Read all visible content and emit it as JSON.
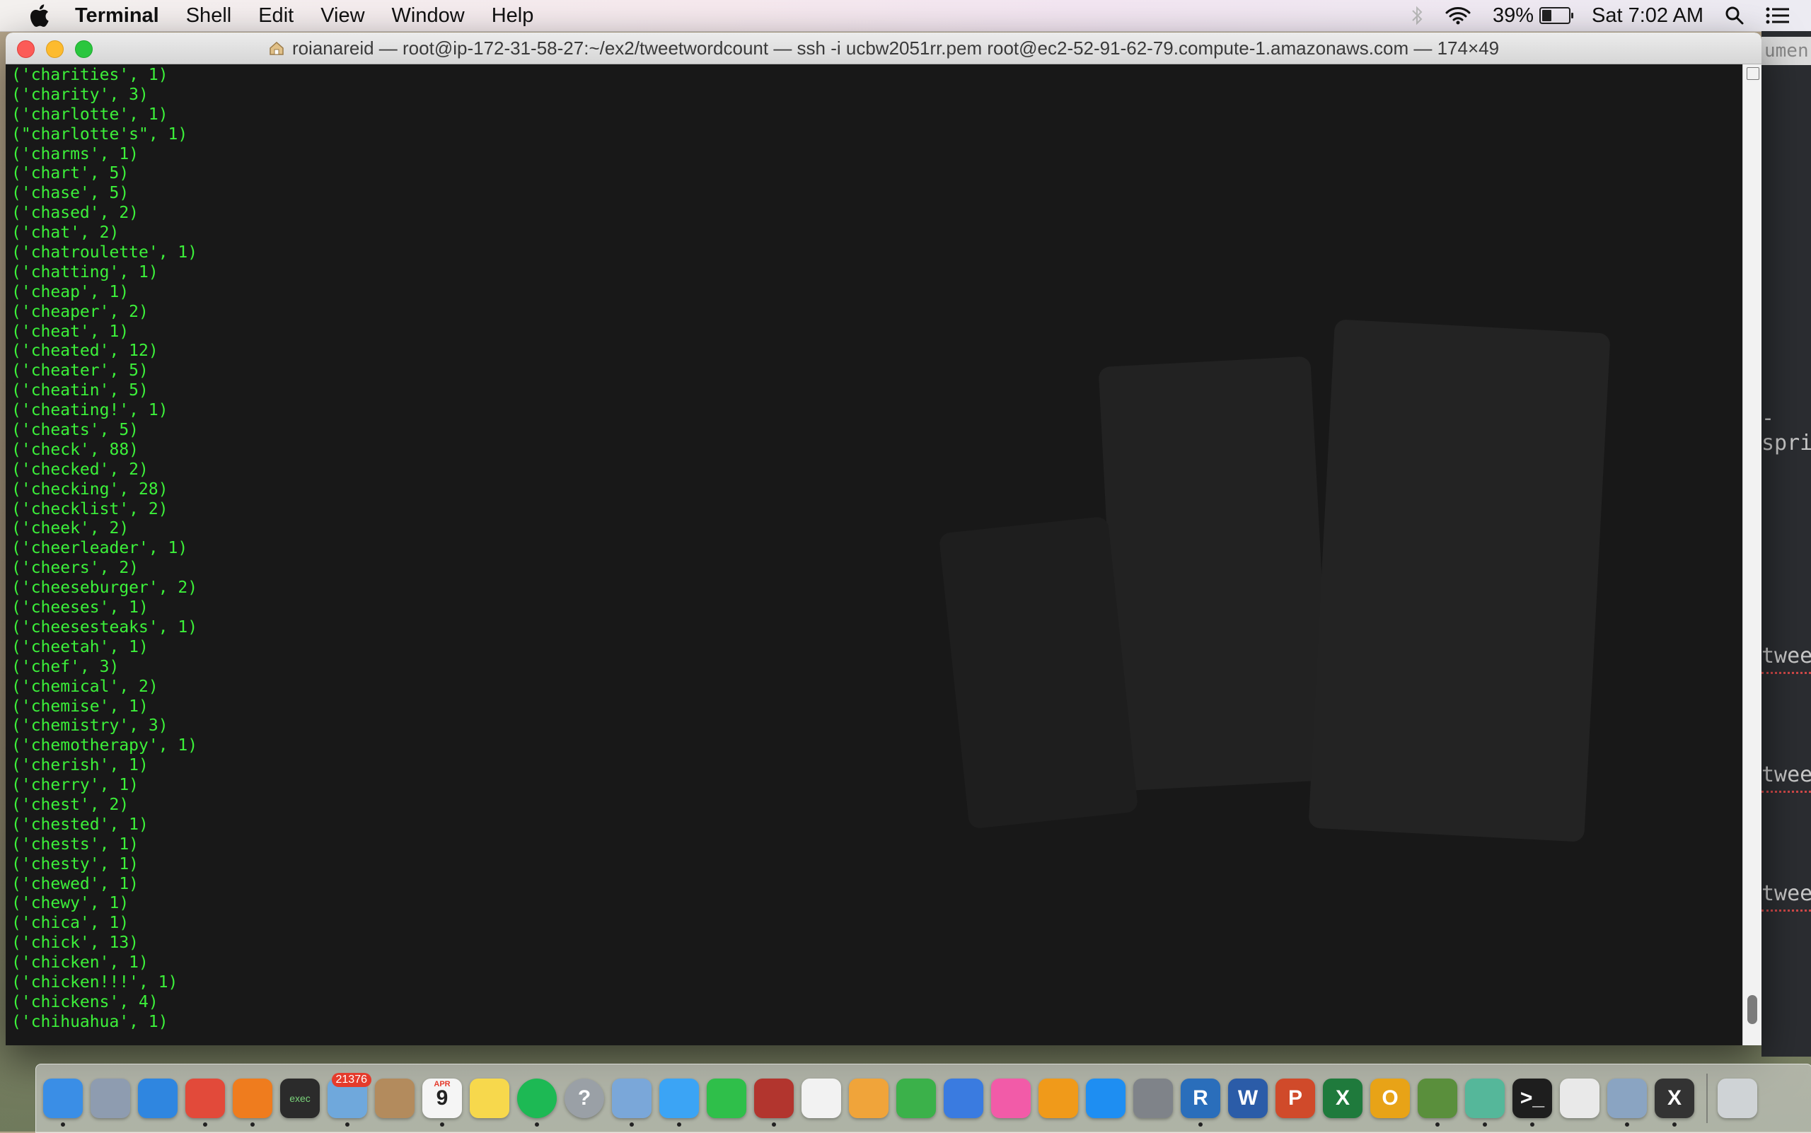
{
  "menubar": {
    "apple_icon": "apple-icon",
    "app_name": "Terminal",
    "menus": [
      "Shell",
      "Edit",
      "View",
      "Window",
      "Help"
    ],
    "battery_percent": "39%",
    "battery_level": 0.39,
    "clock": "Sat 7:02 AM"
  },
  "window": {
    "title": "roianareid — root@ip-172-31-58-27:~/ex2/tweetwordcount — ssh -i ucbw2051rr.pem root@ec2-52-91-62-79.compute-1.amazonaws.com — 174×49",
    "text_color": "#3cf03a",
    "background": "#181818"
  },
  "terminal_lines": [
    "('charities', 1)",
    "('charity', 3)",
    "('charlotte', 1)",
    "(\"charlotte's\", 1)",
    "('charms', 1)",
    "('chart', 5)",
    "('chase', 5)",
    "('chased', 2)",
    "('chat', 2)",
    "('chatroulette', 1)",
    "('chatting', 1)",
    "('cheap', 1)",
    "('cheaper', 2)",
    "('cheat', 1)",
    "('cheated', 12)",
    "('cheater', 5)",
    "('cheatin', 5)",
    "('cheating!', 1)",
    "('cheats', 5)",
    "('check', 88)",
    "('checked', 2)",
    "('checking', 28)",
    "('checklist', 2)",
    "('cheek', 2)",
    "('cheerleader', 1)",
    "('cheers', 2)",
    "('cheeseburger', 2)",
    "('cheeses', 1)",
    "('cheesesteaks', 1)",
    "('cheetah', 1)",
    "('chef', 3)",
    "('chemical', 2)",
    "('chemise', 1)",
    "('chemistry', 3)",
    "('chemotherapy', 1)",
    "('cherish', 1)",
    "('cherry', 1)",
    "('chest', 2)",
    "('chested', 1)",
    "('chests', 1)",
    "('chesty', 1)",
    "('chewed', 1)",
    "('chewy', 1)",
    "('chica', 1)",
    "('chick', 13)",
    "('chicken', 1)",
    "('chicken!!!', 1)",
    "('chickens', 4)",
    "('chihuahua', 1)"
  ],
  "background_editor": {
    "tab_text": "umen",
    "lines": [
      "-spri",
      "tweet",
      "tweet",
      "tweet"
    ]
  },
  "scrollbar": {
    "position": 0.98,
    "visible_fraction": 0.03
  },
  "dock": {
    "items": [
      {
        "name": "finder-icon",
        "label": "",
        "color": "#3a8ee6",
        "running": true
      },
      {
        "name": "launchpad-icon",
        "label": "",
        "color": "#8e9cb0",
        "running": false
      },
      {
        "name": "safari-icon",
        "label": "",
        "color": "#2f86e0",
        "running": false
      },
      {
        "name": "chrome-icon",
        "label": "",
        "color": "#e24a3a",
        "running": true
      },
      {
        "name": "firefox-icon",
        "label": "",
        "color": "#ef7c1e",
        "running": true
      },
      {
        "name": "exec-terminal-icon",
        "label": "exec",
        "color": "#2b2b2b",
        "running": false
      },
      {
        "name": "mail-icon",
        "label": "",
        "color": "#6fa8dc",
        "running": true,
        "badge": "21376"
      },
      {
        "name": "contacts-icon",
        "label": "",
        "color": "#b38b5d",
        "running": false
      },
      {
        "name": "calendar-icon",
        "label": "9",
        "color": "#f5f5f5",
        "running": true,
        "badge_top": "APR"
      },
      {
        "name": "notes-icon",
        "label": "",
        "color": "#f7d84c",
        "running": false
      },
      {
        "name": "spotify-icon",
        "label": "",
        "color": "#1db954",
        "running": true
      },
      {
        "name": "help-icon",
        "label": "?",
        "color": "#9aa0a6",
        "running": false
      },
      {
        "name": "preview-icon",
        "label": "",
        "color": "#7aa7d9",
        "running": true
      },
      {
        "name": "messages-icon",
        "label": "",
        "color": "#3ba4f5",
        "running": true
      },
      {
        "name": "facetime-icon",
        "label": "",
        "color": "#2fbf4a",
        "running": false
      },
      {
        "name": "photo-booth-icon",
        "label": "",
        "color": "#b2352e",
        "running": true
      },
      {
        "name": "photos-icon",
        "label": "",
        "color": "#f2f2f2",
        "running": false
      },
      {
        "name": "pages-icon",
        "label": "",
        "color": "#f0a43a",
        "running": false
      },
      {
        "name": "numbers-icon",
        "label": "",
        "color": "#3bb14a",
        "running": false
      },
      {
        "name": "keynote-icon",
        "label": "",
        "color": "#3a7be0",
        "running": false
      },
      {
        "name": "itunes-icon",
        "label": "",
        "color": "#f25ba8",
        "running": false
      },
      {
        "name": "ibooks-icon",
        "label": "",
        "color": "#f09a1a",
        "running": false
      },
      {
        "name": "app-store-icon",
        "label": "",
        "color": "#1e8ef2",
        "running": false
      },
      {
        "name": "system-preferences-icon",
        "label": "",
        "color": "#7f8389",
        "running": false
      },
      {
        "name": "r-icon",
        "label": "R",
        "color": "#2a6ebb",
        "running": true
      },
      {
        "name": "word-icon",
        "label": "W",
        "color": "#2b5ca8",
        "running": false
      },
      {
        "name": "powerpoint-icon",
        "label": "P",
        "color": "#d04a2a",
        "running": false
      },
      {
        "name": "excel-icon",
        "label": "X",
        "color": "#1f7a3c",
        "running": false
      },
      {
        "name": "outlook-icon",
        "label": "O",
        "color": "#e8a317",
        "running": false
      },
      {
        "name": "network-icon",
        "label": "",
        "color": "#5a8f3c",
        "running": true
      },
      {
        "name": "atom-icon",
        "label": "",
        "color": "#55b79a",
        "running": true
      },
      {
        "name": "terminal-icon",
        "label": ">_",
        "color": "#1e1e1e",
        "running": true
      },
      {
        "name": "textedit-icon",
        "label": "",
        "color": "#e9e9e9",
        "running": false
      },
      {
        "name": "preview-photos-icon",
        "label": "",
        "color": "#8aa4c2",
        "running": true
      },
      {
        "name": "x11-icon",
        "label": "X",
        "color": "#333333",
        "running": true
      },
      {
        "name": "trash-icon",
        "label": "",
        "color": "#cfd3d6",
        "running": false
      }
    ]
  }
}
